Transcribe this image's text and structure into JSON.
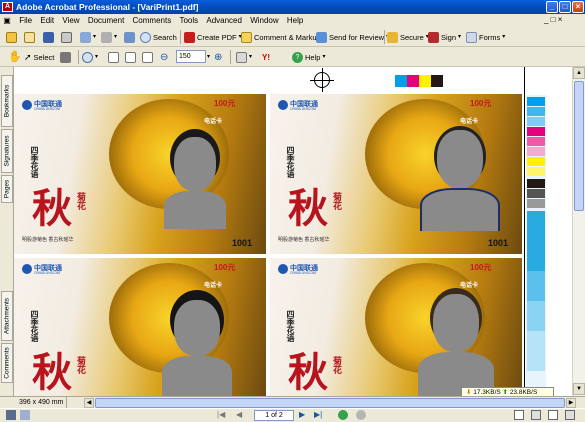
{
  "window": {
    "title": "Adobe Acrobat Professional - [VariPrint1.pdf]",
    "app_icon": "A"
  },
  "menu": [
    "File",
    "Edit",
    "View",
    "Document",
    "Comments",
    "Tools",
    "Advanced",
    "Window",
    "Help"
  ],
  "toolbar1": {
    "search": "Search",
    "create_pdf": "Create PDF",
    "comment": "Comment & Markup",
    "send_review": "Send for Review",
    "secure": "Secure",
    "sign": "Sign",
    "forms": "Forms"
  },
  "toolbar2": {
    "select": "Select",
    "zoom": "150",
    "help": "Help"
  },
  "sidebar": {
    "tabs": [
      "Bookmarks",
      "Signatures",
      "Pages",
      "Attachments",
      "Comments"
    ]
  },
  "page_size": "396 x 490 mm",
  "pagination": {
    "current": "1 of 2"
  },
  "network": {
    "down": "17.3KB/S",
    "up": "23.8KB/S"
  },
  "cards": {
    "logo_cn": "中国联通",
    "logo_en": "CHINA UNICOM",
    "value": "100元",
    "series": "四季花语",
    "big": "秋",
    "sub": "菊花",
    "footer": "明股游菊色 香古秋瑶华",
    "number": "1001",
    "brand_label": "电话卡"
  },
  "colors": {
    "accent": "#0a5ddc",
    "registration_bar": [
      "#00a0e9",
      "#e4007f",
      "#fff100",
      "#231815"
    ]
  },
  "icons": [
    "hand-icon",
    "select-icon",
    "zoom-icon",
    "print-icon",
    "search-icon",
    "email-icon"
  ]
}
